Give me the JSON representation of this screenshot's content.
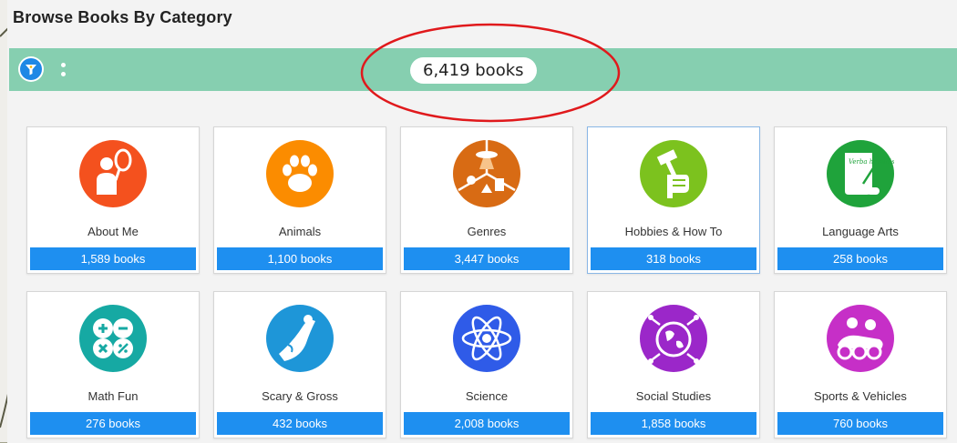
{
  "page": {
    "title": "Browse Books By Category"
  },
  "filter_bar": {
    "total_count": "6,419 books"
  },
  "colors": {
    "bar": "#86cfb0",
    "button_blue": "#1e8ff0",
    "highlight": "#e0191c"
  },
  "categories": [
    {
      "label": "About Me",
      "count": "1,589 books",
      "icon": "person-mirror-icon",
      "color": "#f4511e"
    },
    {
      "label": "Animals",
      "count": "1,100 books",
      "icon": "paw-print-icon",
      "color": "#fb8c00"
    },
    {
      "label": "Genres",
      "count": "3,447 books",
      "icon": "genres-collage-icon",
      "color": "#d86b14"
    },
    {
      "label": "Hobbies & How To",
      "count": "318 books",
      "icon": "fist-hammer-icon",
      "color": "#7cc21e"
    },
    {
      "label": "Language Arts",
      "count": "258 books",
      "icon": "scroll-quill-icon",
      "color": "#1fa33b",
      "scroll_text": "Verba hominis"
    },
    {
      "label": "Math Fun",
      "count": "276 books",
      "icon": "math-symbols-icon",
      "color": "#16a9a3"
    },
    {
      "label": "Scary & Gross",
      "count": "432 books",
      "icon": "slime-slide-icon",
      "color": "#1e96d8"
    },
    {
      "label": "Science",
      "count": "2,008 books",
      "icon": "atom-icon",
      "color": "#2f5be8"
    },
    {
      "label": "Social Studies",
      "count": "1,858 books",
      "icon": "globe-people-icon",
      "color": "#9b27c9"
    },
    {
      "label": "Sports & Vehicles",
      "count": "760 books",
      "icon": "go-kart-icon",
      "color": "#c62fc7"
    }
  ]
}
